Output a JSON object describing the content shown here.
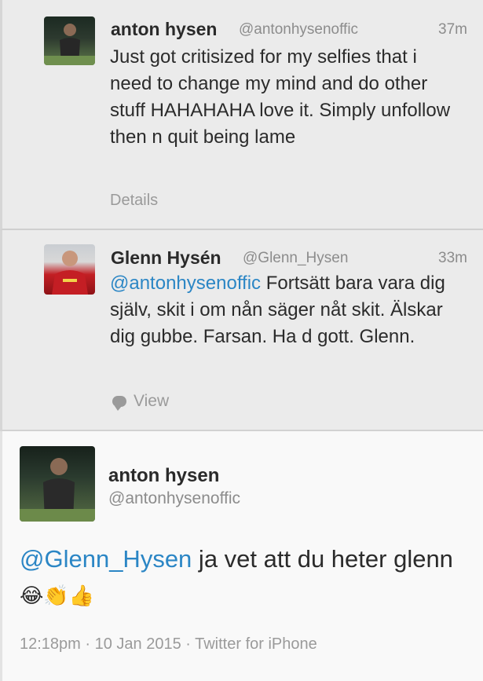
{
  "tweets": [
    {
      "name": "anton hysen",
      "handle": "@antonhysenoffic",
      "time": "37m",
      "text": "Just got critisized for my selfies that i need to change my mind and do other stuff HAHAHAHA love it. Simply unfollow then n quit being lame",
      "action": "Details"
    },
    {
      "name": "Glenn Hysén",
      "handle": "@Glenn_Hysen",
      "time": "33m",
      "mention": "@antonhysenoffic",
      "text": " Fortsätt bara vara dig själv, skit i om nån säger nåt skit. Älskar dig gubbe. Farsan. Ha d gott. Glenn.",
      "action": "View"
    }
  ],
  "main_tweet": {
    "name": "anton hysen",
    "handle": "@antonhysenoffic",
    "mention": "@Glenn_Hysen",
    "text": " ja vet att du heter glenn",
    "emojis": [
      "😂",
      "👏",
      "👍"
    ],
    "timestamp": "12:18pm · 10 Jan 2015 · Twitter for iPhone"
  },
  "icon_names": {
    "view": "speech-bubble-icon"
  }
}
